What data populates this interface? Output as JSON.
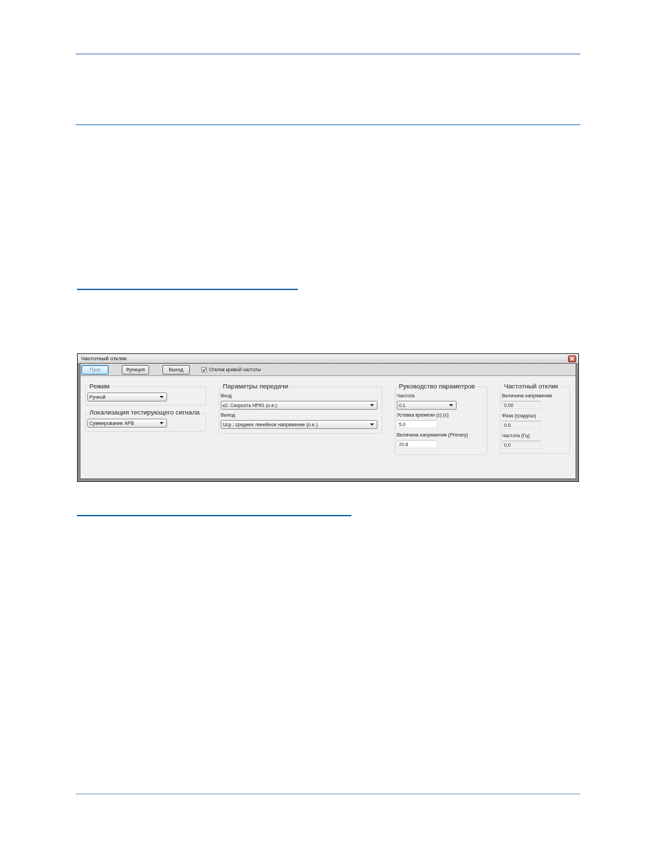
{
  "dialog": {
    "title": "Частотный отклик",
    "toolbar": {
      "buttons": [
        {
          "label": "Пуск",
          "focused": true
        },
        {
          "label": "Функция",
          "focused": false
        },
        {
          "label": "Выход",
          "focused": false
        }
      ],
      "checkbox": {
        "label": "Отклик кривой частоты",
        "checked": true
      }
    },
    "columns": [
      {
        "groups": [
          {
            "title": "Режим",
            "fields": [
              {
                "kind": "select",
                "value": "Ручной"
              }
            ]
          },
          {
            "title": "Локализация тестирующего сигнала",
            "fields": [
              {
                "kind": "select",
                "value": "Суммирование АРВ"
              }
            ]
          }
        ]
      },
      {
        "groups": [
          {
            "title": "Параметры передачи",
            "fields": [
              {
                "kind": "select",
                "label": "Вход",
                "value": "к2: Скорость НР#1 (о.е.)"
              },
              {
                "kind": "select",
                "label": "Выход",
                "value": "Uср.: среднее линейное напряжение (о.е.)"
              }
            ]
          }
        ]
      },
      {
        "groups": [
          {
            "title": "Руководство параметров",
            "fields": [
              {
                "kind": "select",
                "label": "Частота",
                "value": "0.1"
              },
              {
                "kind": "input",
                "label": "Уставка времени (с) (с)",
                "value": "5.0"
              },
              {
                "kind": "input",
                "label": "Величина напряжения (Primary)",
                "value": "20.8"
              }
            ]
          }
        ]
      },
      {
        "groups": [
          {
            "title": "Частотный отклик",
            "fields": [
              {
                "kind": "readonly",
                "label": "Величина напряжения",
                "value": "0.00"
              },
              {
                "kind": "readonly",
                "label": "Фаза (градусы)",
                "value": "0.0"
              },
              {
                "kind": "readonly",
                "label": "Частота (Гц)",
                "value": "0.0"
              }
            ]
          }
        ]
      }
    ]
  }
}
